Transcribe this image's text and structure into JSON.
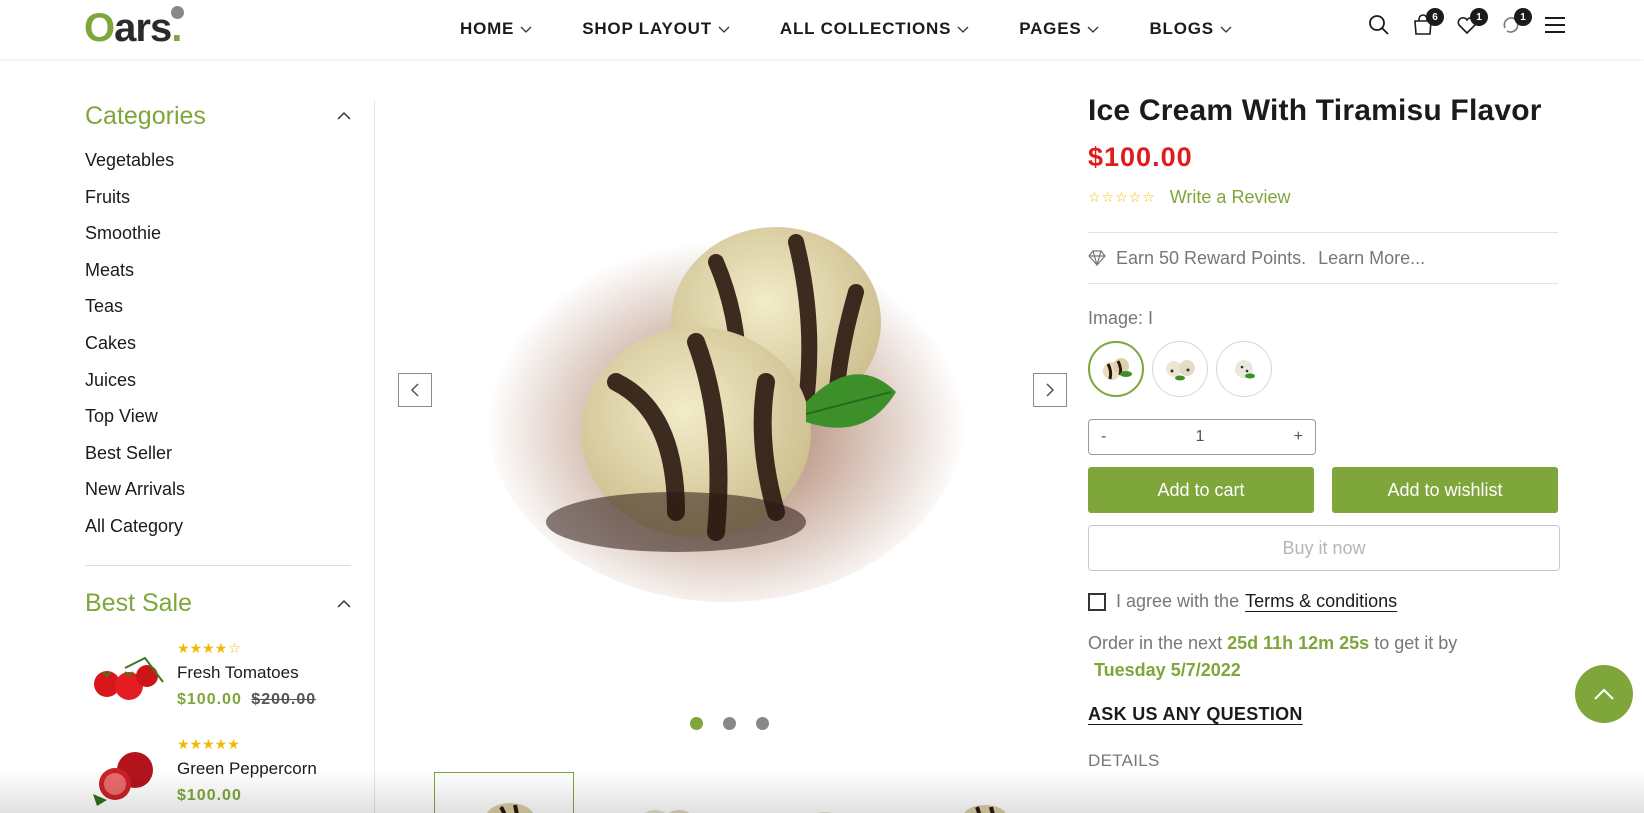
{
  "brand": {
    "logo_o": "O",
    "logo_rest": "ars",
    "logo_dot": "."
  },
  "nav": {
    "items": [
      {
        "label": "HOME"
      },
      {
        "label": "SHOP LAYOUT"
      },
      {
        "label": "ALL COLLECTIONS"
      },
      {
        "label": "PAGES"
      },
      {
        "label": "BLOGS"
      }
    ]
  },
  "header_icons": {
    "search": {
      "icon": "search-icon"
    },
    "cart": {
      "icon": "shopping-bag-icon",
      "count": "6"
    },
    "wishlist": {
      "icon": "heart-icon",
      "count": "1"
    },
    "compare": {
      "icon": "compare-icon",
      "count": "1"
    },
    "menu": {
      "icon": "hamburger-menu-icon"
    }
  },
  "sidebar": {
    "categories_title": "Categories",
    "categories": [
      "Vegetables",
      "Fruits",
      "Smoothie",
      "Meats",
      "Teas",
      "Cakes",
      "Juices",
      "Top View",
      "Best Seller",
      "New Arrivals",
      "All Category"
    ],
    "best_sale_title": "Best Sale",
    "best_sale": [
      {
        "name": "Fresh Tomatoes",
        "price": "$100.00",
        "old_price": "$200.00",
        "rating": 4
      },
      {
        "name": "Green Peppercorn",
        "price": "$100.00",
        "old_price": "",
        "rating": 5
      }
    ]
  },
  "gallery": {
    "slides": 3,
    "active_slide": 1
  },
  "product": {
    "title": "Ice Cream With Tiramisu Flavor",
    "price": "$100.00",
    "rating": 0,
    "write_review": "Write a Review",
    "reward_text": "Earn 50 Reward Points.",
    "reward_link": "Learn More...",
    "image_label": "Image: I",
    "quantity_minus": "-",
    "quantity": "1",
    "quantity_plus": "+",
    "add_to_cart": "Add to cart",
    "add_to_wishlist": "Add to wishlist",
    "buy_now": "Buy it now",
    "agree_text": "I agree with the",
    "terms_link": "Terms & conditions",
    "order_prefix": "Order in the next",
    "countdown": "25d 11h 12m 25s",
    "order_mid": "to get it by",
    "delivery_date": "Tuesday 5/7/2022",
    "ask_question": "ASK US ANY QUESTION",
    "details_label": "DETAILS"
  },
  "colors": {
    "accent": "#7ea63a",
    "price_red": "#e01b1b",
    "star": "#f5b800"
  }
}
